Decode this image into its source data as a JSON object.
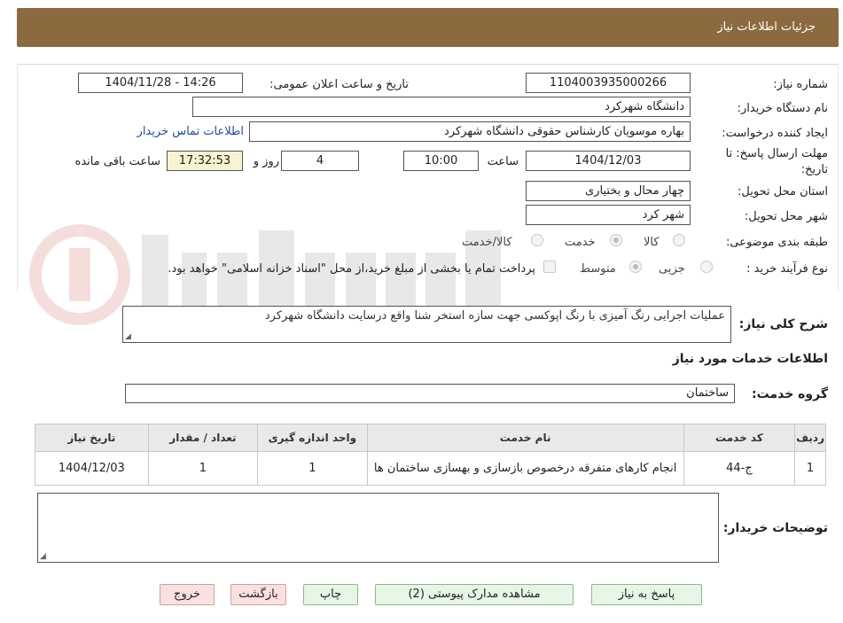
{
  "header": {
    "title": "جزئیات اطلاعات نیاز"
  },
  "fields": {
    "need_number_label": "شماره نیاز:",
    "need_number": "1104003935000266",
    "announce_label": "تاریخ و ساعت اعلان عمومی:",
    "announce_value": "1404/11/28 - 14:26",
    "buyer_org_label": "نام دستگاه خریدار:",
    "buyer_org": "دانشگاه شهرکرد",
    "creator_label": "ایجاد کننده درخواست:",
    "creator": "بهاره موسویان کارشناس حقوقی دانشگاه شهرکرد",
    "contact_link": "اطلاعات تماس خریدار",
    "deadline_label_1": "مهلت ارسال پاسخ: تا",
    "deadline_label_2": "تاریخ:",
    "deadline_date": "1404/12/03",
    "time_label": "ساعت",
    "deadline_time": "10:00",
    "days_value": "4",
    "days_label": "روز و",
    "remaining_time": "17:32:53",
    "remaining_label": "ساعت باقی مانده",
    "province_label": "استان محل تحویل:",
    "province": "چهار محال و بختیاری",
    "city_label": "شهر محل تحویل:",
    "city": "شهر کرد",
    "category_label": "طبقه بندی موضوعی:",
    "cat_goods": "کالا",
    "cat_service": "خدمت",
    "cat_goods_service": "کالا/خدمت",
    "process_label": "نوع فرآیند خرید :",
    "proc_partial": "جزیی",
    "proc_medium": "متوسط",
    "payment_note": "پرداخت تمام یا بخشی از مبلغ خرید،از محل \"اسناد خزانه اسلامی\" خواهد بود."
  },
  "description": {
    "label": "شرح کلی نیاز:",
    "text": "عملیات اجرایی رنگ آمیزی با رنگ اپوکسی جهت سازه  استخر شنا  واقع درسایت دانشگاه شهرکرد"
  },
  "services": {
    "section_title": "اطلاعات خدمات مورد نیاز",
    "group_label": "گروه خدمت:",
    "group_value": "ساختمان",
    "columns": [
      "ردیف",
      "کد خدمت",
      "نام خدمت",
      "واحد اندازه گیری",
      "تعداد / مقدار",
      "تاریخ نیاز"
    ],
    "rows": [
      {
        "row": "1",
        "code": "ج-44",
        "name": "انجام کارهای متفرقه درخصوص بازسازی و بهسازی ساختمان ها",
        "unit": "1",
        "qty": "1",
        "date": "1404/12/03"
      }
    ]
  },
  "buyer_notes": {
    "label": "توضیحات خریدار:"
  },
  "buttons": {
    "reply": "پاسخ به نیاز",
    "attachments": "مشاهده مدارک پیوستی (2)",
    "print": "چاپ",
    "back": "بازگشت",
    "exit": "خروج"
  },
  "colors": {
    "header_bg": "#8c6a3f",
    "link": "#1a4ca8",
    "button_green": "#e6f6e4",
    "button_red": "#fbe0e0"
  }
}
